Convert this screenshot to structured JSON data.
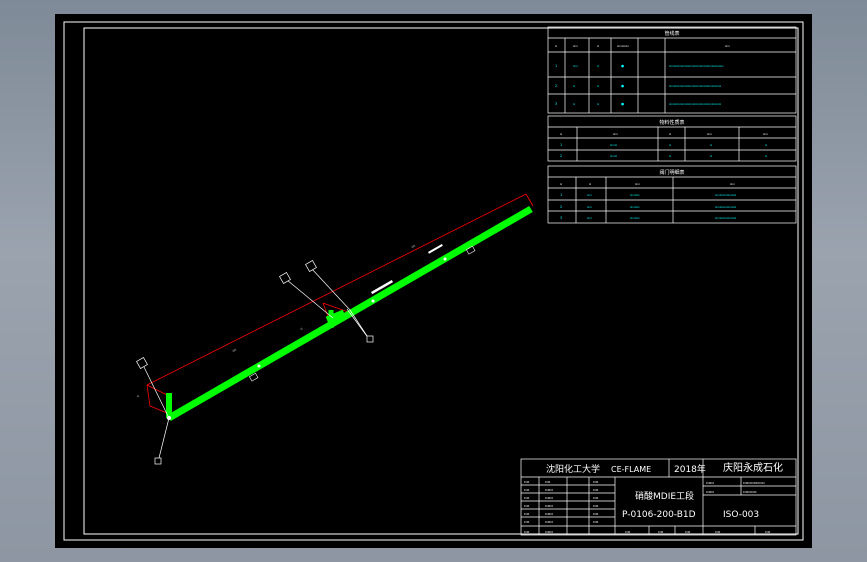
{
  "title_block": {
    "school": "沈阳化工大学",
    "frame": "CE-FLAME",
    "year": "2018年",
    "project": "庆阳永成石化",
    "drawing_name": "硝酸MDIE工段",
    "line_number": "P-0106-200-B1D",
    "drawing_no": "ISO-003"
  },
  "tables": {
    "piping": {
      "title": "管线表"
    },
    "material": {
      "title": "物料性质表"
    },
    "valve": {
      "title": "阀门明细表"
    }
  },
  "colors": {
    "background": "#000000",
    "pipe": "#00ff00",
    "frame_line": "#ffffff",
    "dimension_line": "#ff0000",
    "table_text": "#00ffff"
  }
}
